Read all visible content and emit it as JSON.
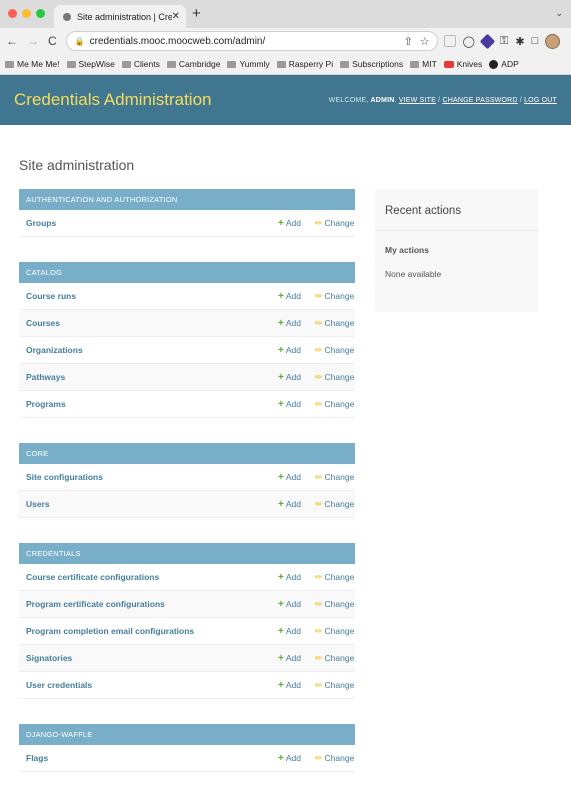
{
  "browser": {
    "tab_title": "Site administration | Credentials",
    "tab_close": "✕",
    "new_tab": "+",
    "tab_menu": "⌄",
    "url": "credentials.mooc.moocweb.com/admin/",
    "colors": {
      "close": "#ff5f57",
      "minimize": "#febc2e",
      "zoom": "#28c840"
    },
    "bookmarks": [
      {
        "label": "Me Me Me!",
        "icon": "folder-icon"
      },
      {
        "label": "StepWise",
        "icon": "folder-icon"
      },
      {
        "label": "Clients",
        "icon": "folder-icon"
      },
      {
        "label": "Cambridge",
        "icon": "folder-icon"
      },
      {
        "label": "Yummly",
        "icon": "folder-icon"
      },
      {
        "label": "Rasperry Pi",
        "icon": "folder-icon"
      },
      {
        "label": "Subscriptions",
        "icon": "folder-icon"
      },
      {
        "label": "MIT",
        "icon": "folder-icon"
      },
      {
        "label": "Knives",
        "icon": "youtube-icon"
      },
      {
        "label": "ADP",
        "icon": "github-icon"
      }
    ]
  },
  "header": {
    "branding": "Credentials Administration",
    "welcome": "Welcome,",
    "user": "admin",
    "view_site": "View site",
    "change_password": "Change password",
    "log_out": "Log out",
    "sep": " / "
  },
  "page": {
    "title": "Site administration"
  },
  "labels": {
    "add": "Add",
    "change": "Change"
  },
  "modules": [
    {
      "caption": "Authentication and Authorization",
      "models": [
        "Groups"
      ]
    },
    {
      "caption": "Catalog",
      "models": [
        "Course runs",
        "Courses",
        "Organizations",
        "Pathways",
        "Programs"
      ]
    },
    {
      "caption": "Core",
      "models": [
        "Site configurations",
        "Users"
      ]
    },
    {
      "caption": "Credentials",
      "models": [
        "Course certificate configurations",
        "Program certificate configurations",
        "Program completion email configurations",
        "Signatories",
        "User credentials"
      ]
    },
    {
      "caption": "Django-Waffle",
      "models": [
        "Flags"
      ]
    }
  ],
  "recent": {
    "title": "Recent actions",
    "my_actions": "My actions",
    "none": "None available"
  }
}
